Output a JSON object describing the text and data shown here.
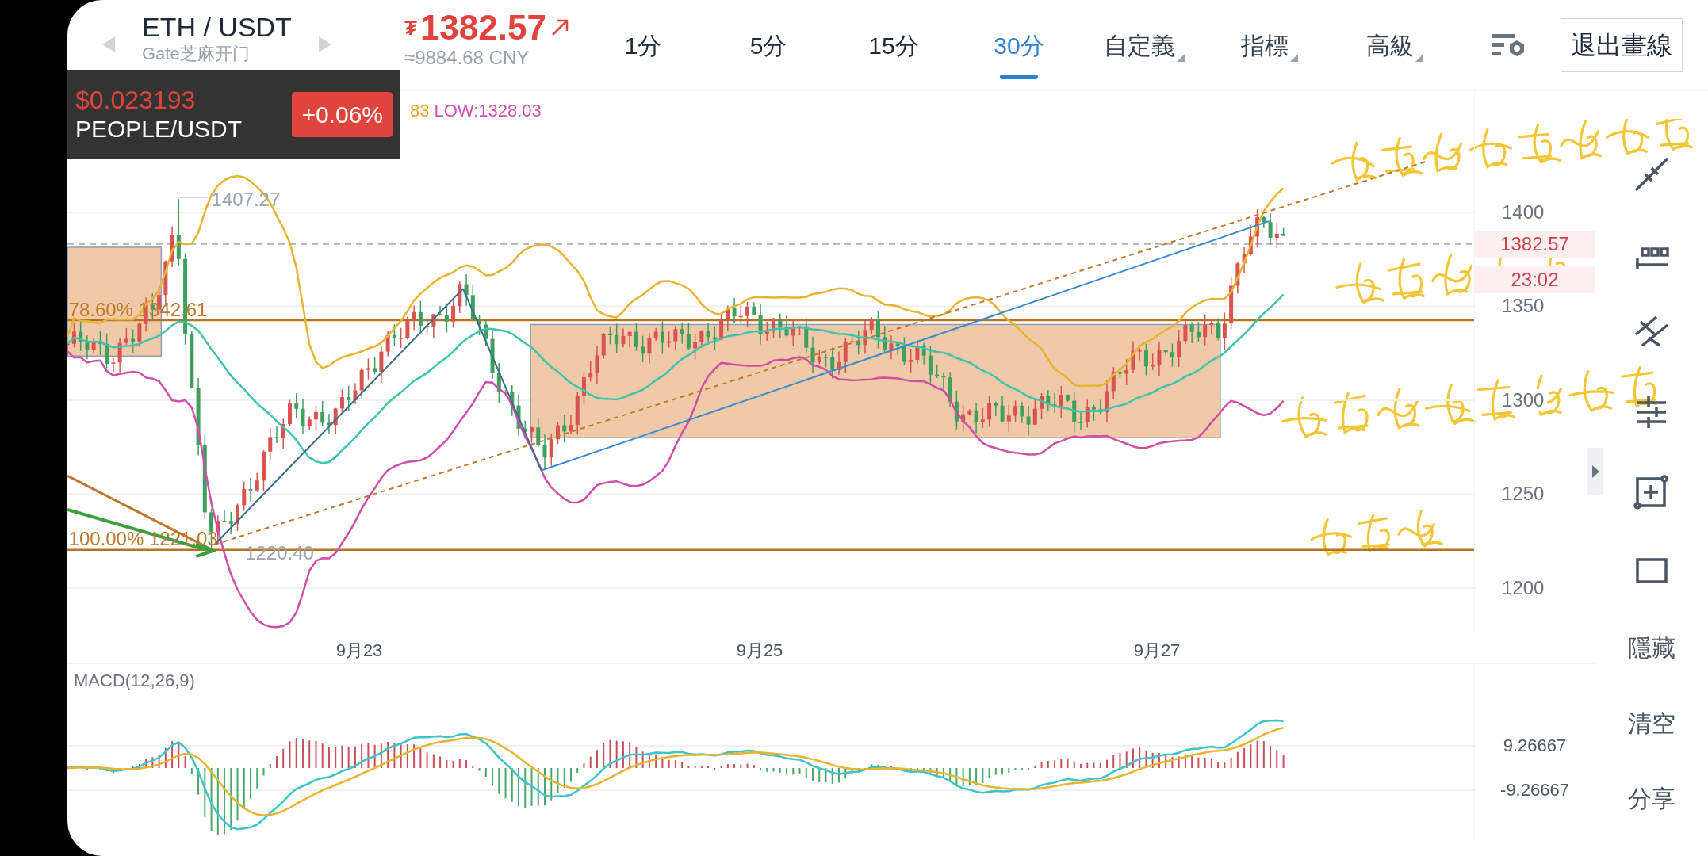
{
  "header": {
    "pair": "ETH / USDT",
    "exchange": "Gate芝麻开门",
    "currency_sign": "₮",
    "price": "1382.57",
    "price_cny": "≈9884.68 CNY"
  },
  "intervals": [
    {
      "label": "1分",
      "selected": false
    },
    {
      "label": "5分",
      "selected": false
    },
    {
      "label": "15分",
      "selected": false
    },
    {
      "label": "30分",
      "selected": true
    }
  ],
  "menus": [
    {
      "label": "自定義"
    },
    {
      "label": "指標"
    },
    {
      "label": "高級"
    }
  ],
  "exit_button": "退出畫線",
  "ticker_popup": {
    "price": "$0.023193",
    "pair": "PEOPLE/USDT",
    "change": "+0.06%"
  },
  "boll_legend": [
    {
      "text": "83",
      "color": "#e0a820"
    },
    {
      "text": "LOW:1328.03",
      "color": "#d050b0"
    }
  ],
  "chart_labels": {
    "high": "1407.27",
    "low": "1220.40",
    "fib_786": "78.60% 1342.61",
    "fib_100": "100.00% 1221.03"
  },
  "price_axis": [
    "1400",
    "1350",
    "1300",
    "1250",
    "1200"
  ],
  "current_price": "1382.57",
  "countdown": "23:02",
  "date_axis": [
    "9月23",
    "9月25",
    "9月27"
  ],
  "macd": {
    "title": "MACD(12,26,9)",
    "axis": [
      "9.26667",
      "-9.26667"
    ]
  },
  "side_actions": [
    "隱藏",
    "清空",
    "分享"
  ]
}
